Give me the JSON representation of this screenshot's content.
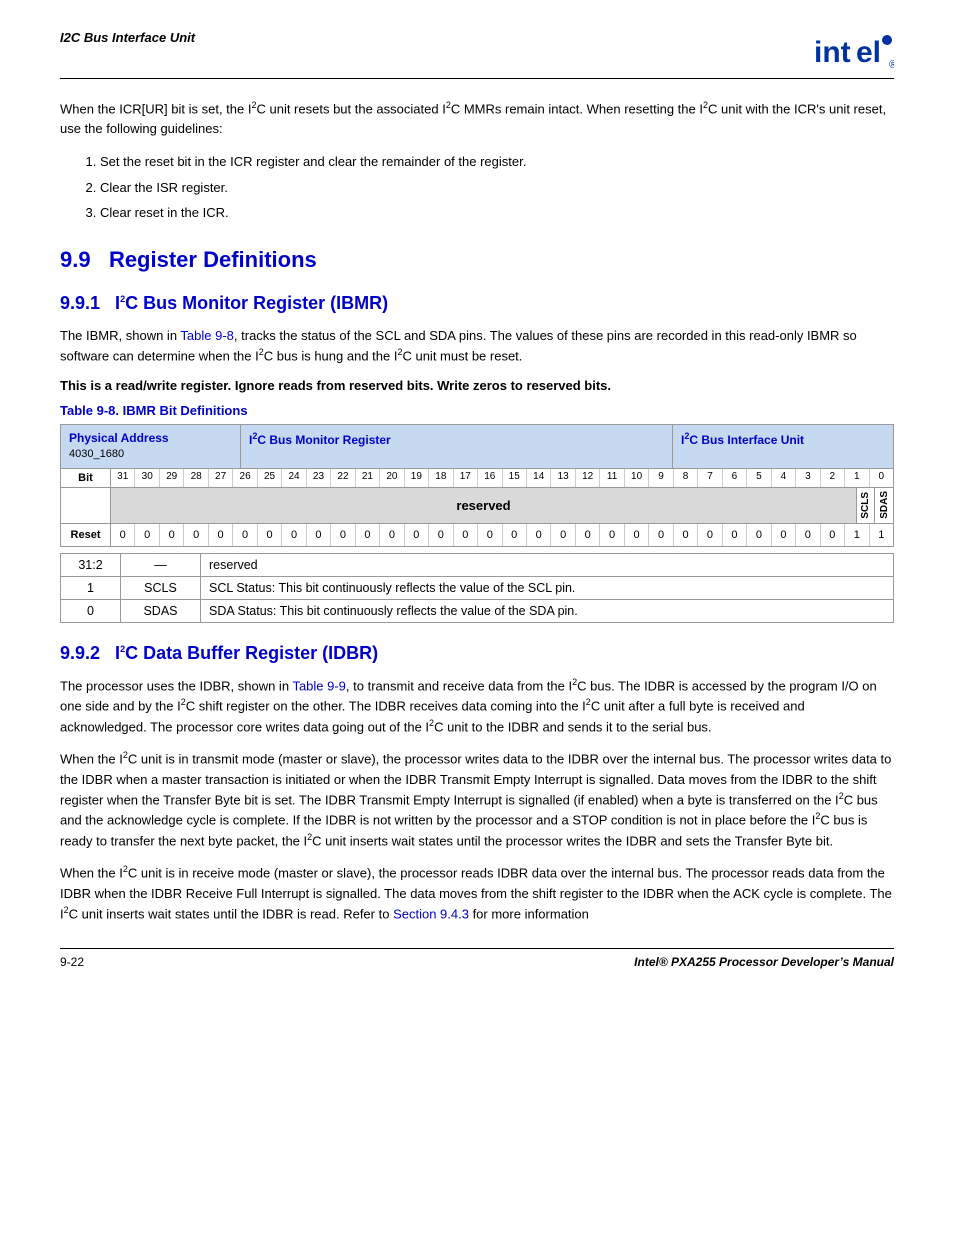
{
  "header": {
    "title": "I2C Bus Interface Unit",
    "logo": "int◊el"
  },
  "intro": {
    "para1": "When the ICR[UR] bit is set, the I²C unit resets but the associated I²C MMRs remain intact. When resetting the I²C unit with the ICR’s unit reset, use the following guidelines:",
    "list": [
      "Set the reset bit in the ICR register and clear the remainder of the register.",
      "Clear the ISR register.",
      "Clear reset in the ICR."
    ]
  },
  "section99": {
    "number": "9.9",
    "title": "Register Definitions"
  },
  "section991": {
    "number": "9.9.1",
    "title_prefix": "I",
    "title_main": "C Bus Monitor Register (IBMR)",
    "para1": "The IBMR, shown in Table 9-8, tracks the status of the SCL and SDA pins. The values of these pins are recorded in this read-only IBMR so software can determine when the I²C bus is hung and the I²C unit must be reset.",
    "bold_note": "This is a read/write register. Ignore reads from reserved bits. Write zeros to reserved bits.",
    "table_title": "Table 9-8.  IBMR Bit Definitions",
    "table": {
      "col1_label": "Physical Address",
      "col1_addr": "4030_1680",
      "col2_label": "I²C Bus Monitor Register",
      "col3_label": "I²C Bus Interface Unit",
      "bit_numbers": [
        "31",
        "30",
        "29",
        "28",
        "27",
        "26",
        "25",
        "24",
        "23",
        "22",
        "21",
        "20",
        "19",
        "18",
        "17",
        "16",
        "15",
        "14",
        "13",
        "12",
        "11",
        "10",
        "9",
        "8",
        "7",
        "6",
        "5",
        "4",
        "3",
        "2",
        "1",
        "0"
      ],
      "reserved_label": "reserved",
      "scls_label": "SCLS",
      "sdas_label": "SDAS",
      "reset_values": [
        "0",
        "0",
        "0",
        "0",
        "0",
        "0",
        "0",
        "0",
        "0",
        "0",
        "0",
        "0",
        "0",
        "0",
        "0",
        "0",
        "0",
        "0",
        "0",
        "0",
        "0",
        "0",
        "0",
        "0",
        "0",
        "0",
        "0",
        "0",
        "0",
        "0",
        "1",
        "1"
      ],
      "definitions": [
        {
          "bits": "31:2",
          "name": "—",
          "desc": "reserved"
        },
        {
          "bits": "1",
          "name": "SCLS",
          "desc": "SCL Status: This bit continuously reflects the value of the SCL pin."
        },
        {
          "bits": "0",
          "name": "SDAS",
          "desc": "SDA Status: This bit continuously reflects the value of the SDA pin."
        }
      ]
    }
  },
  "section992": {
    "number": "9.9.2",
    "title_prefix": "I",
    "title_main": "C Data Buffer Register (IDBR)",
    "para1": "The processor uses the IDBR, shown in Table 9-9, to transmit and receive data from the I²C bus. The IDBR is accessed by the program I/O on one side and by the I²C shift register on the other. The IDBR receives data coming into the I²C unit after a full byte is received and acknowledged. The processor core writes data going out of the I²C unit to the IDBR and sends it to the serial bus.",
    "para2": "When the I²C unit is in transmit mode (master or slave), the processor writes data to the IDBR over the internal bus. The processor writes data to the IDBR when a master transaction is initiated or when the IDBR Transmit Empty Interrupt is signalled. Data moves from the IDBR to the shift register when the Transfer Byte bit is set. The IDBR Transmit Empty Interrupt is signalled (if enabled) when a byte is transferred on the I²C bus and the acknowledge cycle is complete. If the IDBR is not written by the processor and a STOP condition is not in place before the I²C bus is ready to transfer the next byte packet, the I²C unit inserts wait states until the processor writes the IDBR and sets the Transfer Byte bit.",
    "para3": "When the I²C unit is in receive mode (master or slave), the processor reads IDBR data over the internal bus. The processor reads data from the IDBR when the IDBR Receive Full Interrupt is signalled. The data moves from the shift register to the IDBR when the ACK cycle is complete. The I²C unit inserts wait states until the IDBR is read. Refer to Section 9.4.3 for more information"
  },
  "footer": {
    "left": "9-22",
    "right": "Intel® PXA255 Processor Developer’s Manual"
  }
}
